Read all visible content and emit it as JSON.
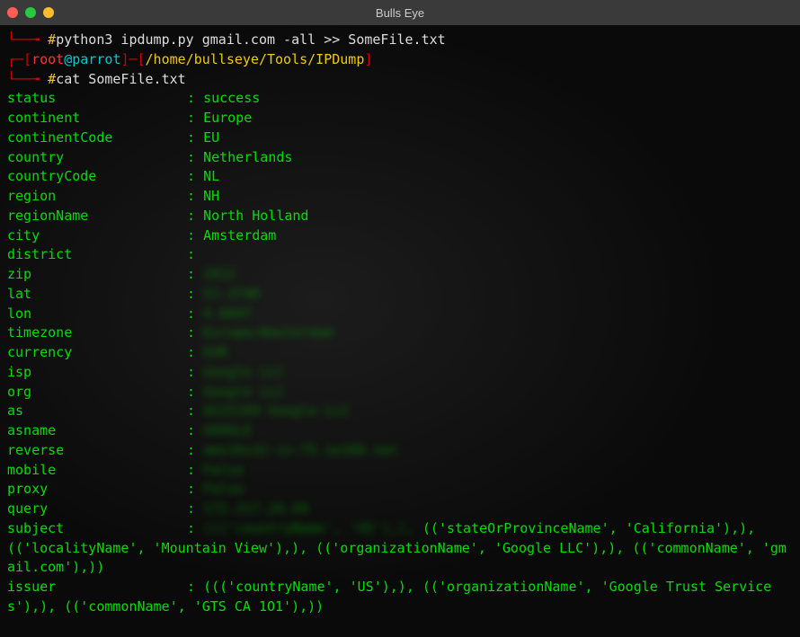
{
  "window": {
    "title": "Bulls Eye"
  },
  "prompt1": {
    "corner": "└──╼",
    "hash": "#",
    "command": "python3 ipdump.py gmail.com -all >> SomeFile.txt"
  },
  "prompt2": {
    "prefix": "┌─[",
    "user": "root",
    "at": "@",
    "host": "parrot",
    "suffix": "]─[",
    "path": "/home/bullseye/Tools/IPDump",
    "close": "]"
  },
  "prompt3": {
    "corner": "└──╼",
    "hash": "#",
    "command": "cat SomeFile.txt"
  },
  "rows": [
    {
      "key": "status",
      "value": "success",
      "blurred": false
    },
    {
      "key": "continent",
      "value": "Europe",
      "blurred": false
    },
    {
      "key": "continentCode",
      "value": "EU",
      "blurred": false
    },
    {
      "key": "country",
      "value": "Netherlands",
      "blurred": false
    },
    {
      "key": "countryCode",
      "value": "NL",
      "blurred": false
    },
    {
      "key": "region",
      "value": "NH",
      "blurred": false
    },
    {
      "key": "regionName",
      "value": "North Holland",
      "blurred": false
    },
    {
      "key": "city",
      "value": "Amsterdam",
      "blurred": false
    },
    {
      "key": "district",
      "value": "",
      "blurred": false
    },
    {
      "key": "zip",
      "value": "1012",
      "blurred": true
    },
    {
      "key": "lat",
      "value": "52.3740",
      "blurred": true
    },
    {
      "key": "lon",
      "value": "4.8897",
      "blurred": true
    },
    {
      "key": "timezone",
      "value": "Europe/Amsterdam",
      "blurred": true
    },
    {
      "key": "currency",
      "value": "EUR",
      "blurred": true
    },
    {
      "key": "isp",
      "value": "Google LLC",
      "blurred": true
    },
    {
      "key": "org",
      "value": "Google LLC",
      "blurred": true
    },
    {
      "key": "as",
      "value": "AS15169 Google LLC",
      "blurred": true
    },
    {
      "key": "asname",
      "value": "GOOGLE",
      "blurred": true
    },
    {
      "key": "reverse",
      "value": "ams16s32-in-f5.1e100.net",
      "blurred": true
    },
    {
      "key": "mobile",
      "value": "False",
      "blurred": true
    },
    {
      "key": "proxy",
      "value": "False",
      "blurred": true
    },
    {
      "key": "query",
      "value": "172.217.20.69",
      "blurred": true
    }
  ],
  "subject": {
    "key": "subject",
    "prefix_blurred": "((('countryName', 'US'),), ",
    "tail": "(('stateOrProvinceName', 'California'),), (('localityName', 'Mountain View'),), (('organizationName', 'Google LLC'),), (('commonName', 'gmail.com'),))"
  },
  "issuer": {
    "key": "issuer",
    "value": "((('countryName', 'US'),), (('organizationName', 'Google Trust Services'),), (('commonName', 'GTS CA 1O1'),))"
  }
}
